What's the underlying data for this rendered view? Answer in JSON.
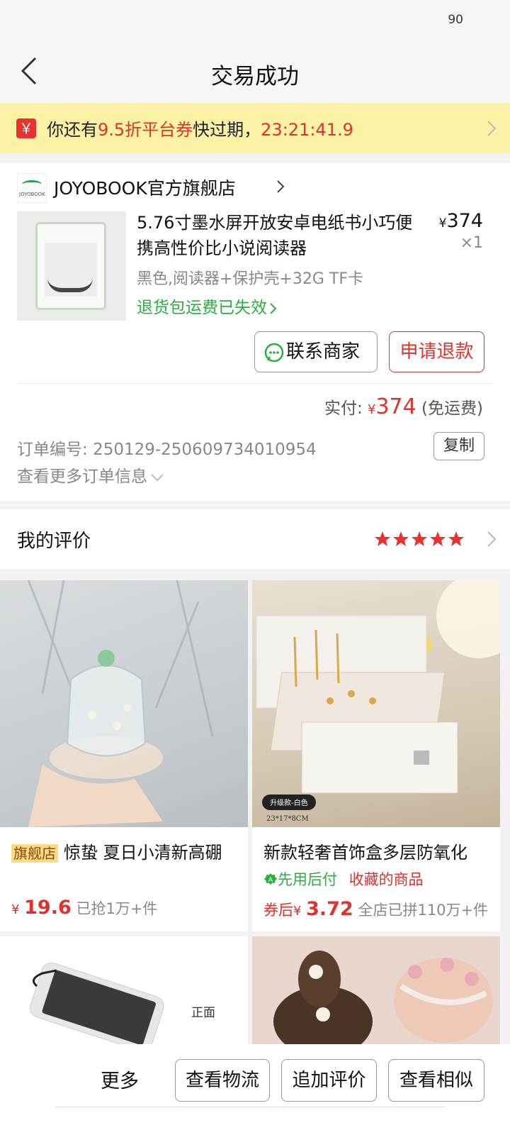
{
  "status_bar": {
    "battery": "90"
  },
  "nav": {
    "title": "交易成功"
  },
  "coupon": {
    "prefix": "你还有",
    "highlight": "9.5折平台券",
    "middle": "快过期，",
    "countdown": "23:21:41.9",
    "icon_glyph": "￥"
  },
  "store": {
    "logo_text": "JOYOBOOK",
    "name": "JOYOBOOK官方旗舰店"
  },
  "product": {
    "title": "5.76寸墨水屏开放安卓电纸书小巧便携高性价比小说阅读器",
    "price_symbol": "¥",
    "price": "374",
    "quantity": "×1",
    "spec": "黑色,阅读器+保护壳+32G TF卡",
    "return_notice": "退货包运费已失效"
  },
  "actions": {
    "contact": "联系商家",
    "refund": "申请退款"
  },
  "payment": {
    "label": "实付:",
    "currency": "¥",
    "amount": "374",
    "note": "(免运费)"
  },
  "order": {
    "number_label": "订单编号:",
    "number": "250129-250609734010954",
    "copy": "复制",
    "more_info": "查看更多订单信息"
  },
  "review": {
    "title": "我的评价",
    "stars": 5
  },
  "recommendations": [
    {
      "badge": "旗舰店",
      "name": "惊蛰 夏日小清新高硼",
      "currency": "¥",
      "price": "19.6",
      "sold": "已抢1万+件"
    },
    {
      "name": "新款轻奢首饰盒多层防氧化",
      "tag_pay": "先用后付",
      "tag_fav": "收藏的商品",
      "price_prefix": "券后",
      "currency": "¥",
      "price": "3.72",
      "sold": "全店已拼110万+件",
      "image_badge": "升级款-白色",
      "image_size": "23*17*8CM"
    },
    {
      "image_label": "正面"
    },
    {}
  ],
  "bottom": {
    "more": "更多",
    "logistics": "查看物流",
    "add_review": "追加评价",
    "similar": "查看相似"
  },
  "colors": {
    "accent_red": "#e0312b",
    "green": "#2cae3f",
    "coupon_bg": "#fbf2a6"
  }
}
